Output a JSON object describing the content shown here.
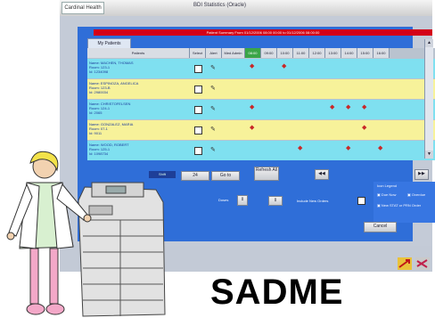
{
  "app": {
    "tab_label": "Cardinal Health",
    "title": "BDI Statistics (Oracle)"
  },
  "panel": {
    "redbar_text": "Patient Summary From 01/12/2006  08:00 00:00 to 01/12/2006  08:00:00",
    "tab_label": "My Patients"
  },
  "table": {
    "headers": [
      "Patients",
      "Select",
      "Alert",
      "Med Admin Due",
      "08:00",
      "09:00",
      "10:00",
      "11:00",
      "12:00",
      "13:00",
      "14:00",
      "15:00",
      "16:00"
    ],
    "rows": [
      {
        "name": "Name: MACHEN, THOMAS",
        "room": "Room: 123-1",
        "id": "Id: 1234098",
        "bg": "cyan",
        "alert": true
      },
      {
        "name": "Name: ESPINOZA, ANGELICA",
        "room": "Room: 123-B",
        "id": "Id: 2980034",
        "bg": "yellow",
        "alert": true
      },
      {
        "name": "Name: CHRISTOFELSEN",
        "room": "Room: 124-1",
        "id": "Id: 2065",
        "bg": "cyan",
        "alert": true
      },
      {
        "name": "Name: GONZALEZ, MARIA",
        "room": "Room: 07-1",
        "id": "Id: 9011",
        "bg": "yellow",
        "alert": true
      },
      {
        "name": "Name: WOOD, ROBERT",
        "room": "Room: 125-1",
        "id": "Id: 1098734",
        "bg": "cyan",
        "alert": true
      }
    ]
  },
  "controls": {
    "shift_label": "Shift",
    "hour_value": "24",
    "next_label": "Go to",
    "refresh_label": "Refresh All",
    "prev_icon": "rewind-icon",
    "next_icon": "fast-forward-icon",
    "dose_label": "Doses",
    "time_label": "Include New Orders",
    "cancel_label": "Cancel"
  },
  "legend": {
    "title": "Icon Legend",
    "items": [
      "Due Now",
      "Overdue",
      "New STAT or PRN Order",
      "Scheduled"
    ]
  },
  "caption": "SADME"
}
